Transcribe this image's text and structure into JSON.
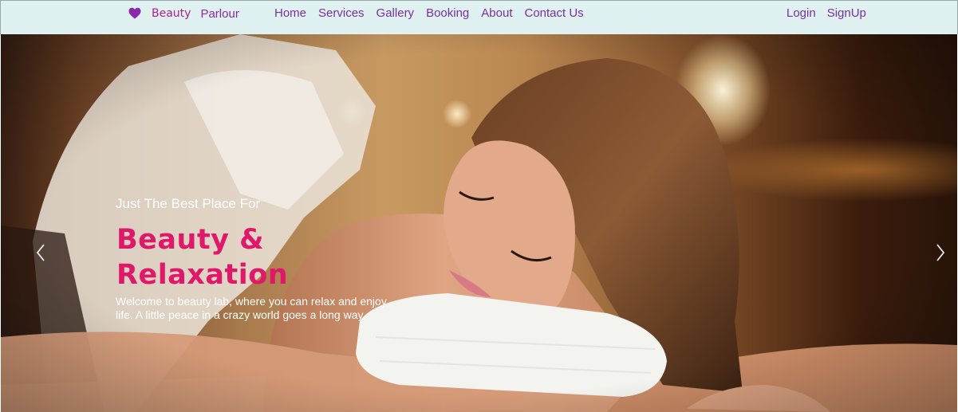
{
  "navbar": {
    "brand": {
      "icon": "heart-icon",
      "icon_color": "#8a2aa8",
      "beauty": "Beauty",
      "parlour": "Parlour"
    },
    "links": [
      "Home",
      "Services",
      "Gallery",
      "Booking",
      "About",
      "Contact Us"
    ],
    "auth": {
      "login": "Login",
      "signup": "SignUp"
    },
    "background_color": "#dff1f1",
    "link_color": "#7a2ea4"
  },
  "hero": {
    "subheading": "Just The Best Place For",
    "headline": "Beauty & Relaxation",
    "headline_color": "#e0186a",
    "description": "Welcome to beauty lab, where you can relax and enjoy life. A little peace in a crazy world goes a long way.",
    "prev_icon": "chevron-left-icon",
    "next_icon": "chevron-right-icon"
  }
}
